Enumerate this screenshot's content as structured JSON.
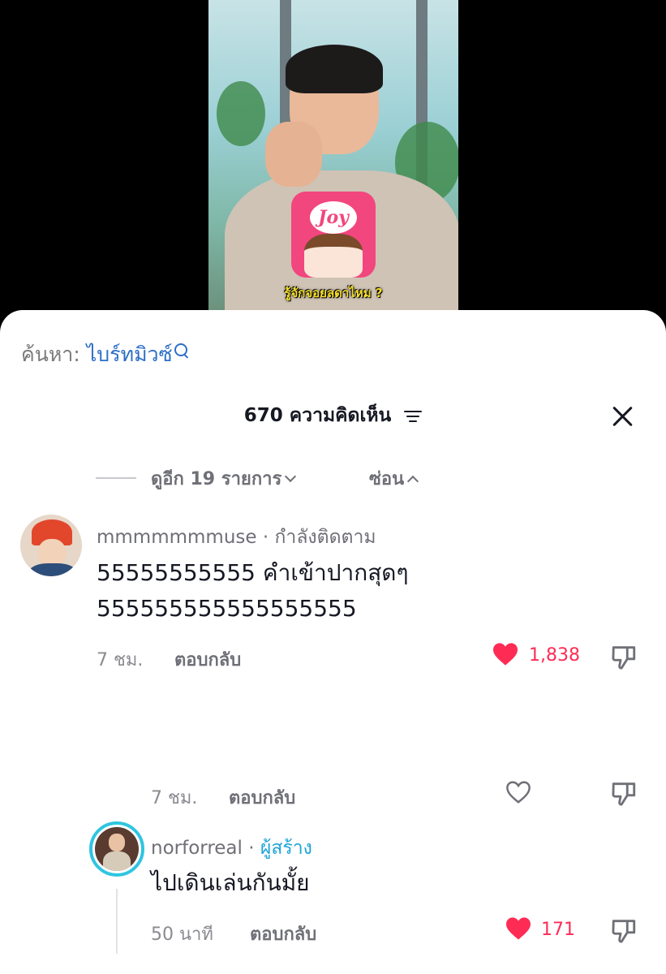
{
  "video": {
    "caption": "รู้จักจอยลดาไหม ?",
    "logo_text": "Joy"
  },
  "search": {
    "label": "ค้นหา:",
    "term": "ไบร์ทมิวซ์"
  },
  "header": {
    "title": "670 ความคิดเห็น"
  },
  "replies_toggle": {
    "more": "ดูอีก 19 รายการ",
    "hide": "ซ่อน"
  },
  "comments": [
    {
      "username": "mmmmmmmuse",
      "separator": "·",
      "status": "กำลังติดตาม",
      "text_line1": "55555555555 คำเข้าปากสุดๆ",
      "text_line2": "555555555555555555",
      "time": "7 ชม.",
      "reply_label": "ตอบกลับ",
      "likes": "1,838"
    },
    {
      "time": "7 ชม.",
      "reply_label": "ตอบกลับ"
    },
    {
      "username": "norforreal",
      "separator": "·",
      "status": "ผู้สร้าง",
      "text": "ไปเดินเล่นกันมั้ย",
      "time": "50 นาที",
      "reply_label": "ตอบกลับ",
      "likes": "171"
    }
  ],
  "colors": {
    "like": "#fe2c55",
    "creator": "#1da4d8",
    "search_term": "#2c6fc6"
  }
}
